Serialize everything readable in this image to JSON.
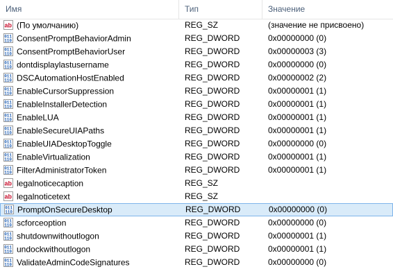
{
  "columns": {
    "name": "Имя",
    "type": "Тип",
    "data": "Значение"
  },
  "rows": [
    {
      "name": "(По умолчанию)",
      "type": "REG_SZ",
      "data": "(значение не присвоено)",
      "icon": "string-value-icon"
    },
    {
      "name": "ConsentPromptBehaviorAdmin",
      "type": "REG_DWORD",
      "data": "0x00000000 (0)",
      "icon": "binary-value-icon"
    },
    {
      "name": "ConsentPromptBehaviorUser",
      "type": "REG_DWORD",
      "data": "0x00000003 (3)",
      "icon": "binary-value-icon"
    },
    {
      "name": "dontdisplaylastusername",
      "type": "REG_DWORD",
      "data": "0x00000000 (0)",
      "icon": "binary-value-icon"
    },
    {
      "name": "DSCAutomationHostEnabled",
      "type": "REG_DWORD",
      "data": "0x00000002 (2)",
      "icon": "binary-value-icon"
    },
    {
      "name": "EnableCursorSuppression",
      "type": "REG_DWORD",
      "data": "0x00000001 (1)",
      "icon": "binary-value-icon"
    },
    {
      "name": "EnableInstallerDetection",
      "type": "REG_DWORD",
      "data": "0x00000001 (1)",
      "icon": "binary-value-icon"
    },
    {
      "name": "EnableLUA",
      "type": "REG_DWORD",
      "data": "0x00000001 (1)",
      "icon": "binary-value-icon"
    },
    {
      "name": "EnableSecureUIAPaths",
      "type": "REG_DWORD",
      "data": "0x00000001 (1)",
      "icon": "binary-value-icon"
    },
    {
      "name": "EnableUIADesktopToggle",
      "type": "REG_DWORD",
      "data": "0x00000000 (0)",
      "icon": "binary-value-icon"
    },
    {
      "name": "EnableVirtualization",
      "type": "REG_DWORD",
      "data": "0x00000001 (1)",
      "icon": "binary-value-icon"
    },
    {
      "name": "FilterAdministratorToken",
      "type": "REG_DWORD",
      "data": "0x00000001 (1)",
      "icon": "binary-value-icon"
    },
    {
      "name": "legalnoticecaption",
      "type": "REG_SZ",
      "data": "",
      "icon": "string-value-icon"
    },
    {
      "name": "legalnoticetext",
      "type": "REG_SZ",
      "data": "",
      "icon": "string-value-icon"
    },
    {
      "name": "PromptOnSecureDesktop",
      "type": "REG_DWORD",
      "data": "0x00000000 (0)",
      "icon": "binary-value-icon",
      "selected": true
    },
    {
      "name": "scforceoption",
      "type": "REG_DWORD",
      "data": "0x00000000 (0)",
      "icon": "binary-value-icon"
    },
    {
      "name": "shutdownwithoutlogon",
      "type": "REG_DWORD",
      "data": "0x00000001 (1)",
      "icon": "binary-value-icon"
    },
    {
      "name": "undockwithoutlogon",
      "type": "REG_DWORD",
      "data": "0x00000001 (1)",
      "icon": "binary-value-icon"
    },
    {
      "name": "ValidateAdminCodeSignatures",
      "type": "REG_DWORD",
      "data": "0x00000000 (0)",
      "icon": "binary-value-icon"
    }
  ],
  "colors": {
    "header_text": "#4c607a",
    "selection_fill": "#d9ebf9",
    "selection_border": "#7eb4ea",
    "string_icon_red": "#c8102e",
    "binary_icon_blue": "#1f5fb5"
  }
}
